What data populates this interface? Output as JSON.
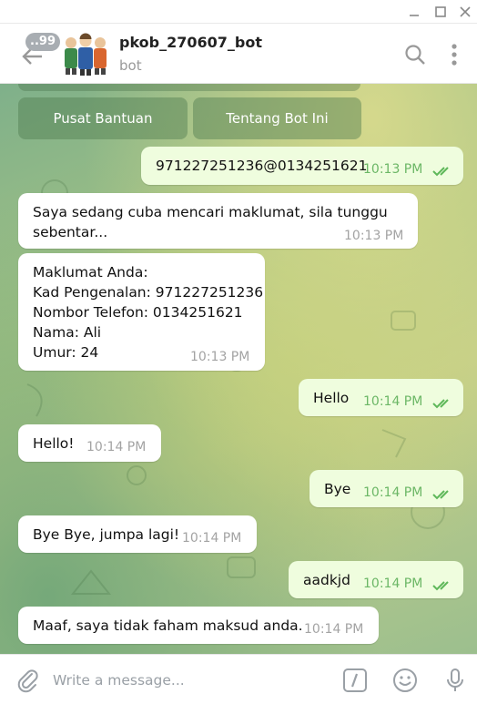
{
  "window": {
    "minimize_icon": "minimize-icon",
    "maximize_icon": "maximize-icon",
    "close_icon": "close-icon"
  },
  "header": {
    "unread_badge": "..99",
    "bot_name": "pkob_270607_bot",
    "status": "bot",
    "icons": [
      "back-arrow-icon",
      "search-icon",
      "more-vertical-icon"
    ]
  },
  "keyboard": {
    "buttons": [
      "Pusat Bantuan",
      "Tentang Bot Ini"
    ]
  },
  "messages": [
    {
      "direction": "out",
      "text": "971227251236@0134251621",
      "time": "10:13 PM",
      "read": true
    },
    {
      "direction": "in",
      "text": "Saya sedang cuba mencari maklumat, sila tunggu\nsebentar...",
      "time": "10:13 PM"
    },
    {
      "direction": "in",
      "text": "Maklumat Anda:\nKad Pengenalan: 971227251236\nNombor Telefon: 0134251621\nNama: Ali\nUmur: 24",
      "time": "10:13 PM"
    },
    {
      "direction": "out",
      "text": "Hello",
      "time": "10:14 PM",
      "read": true
    },
    {
      "direction": "in",
      "text": "Hello!",
      "time": "10:14 PM"
    },
    {
      "direction": "out",
      "text": "Bye",
      "time": "10:14 PM",
      "read": true
    },
    {
      "direction": "in",
      "text": "Bye Bye, jumpa lagi!",
      "time": "10:14 PM"
    },
    {
      "direction": "out",
      "text": "aadkjd",
      "time": "10:14 PM",
      "read": true
    },
    {
      "direction": "in",
      "text": "Maaf, saya tidak faham maksud anda.",
      "time": "10:14 PM"
    }
  ],
  "composer": {
    "placeholder": "Write a message...",
    "value": "",
    "icons": [
      "paperclip-icon",
      "bot-command-icon",
      "emoji-icon",
      "microphone-icon"
    ]
  },
  "colors": {
    "outgoing_bubble": "#effdde",
    "incoming_bubble": "#ffffff",
    "read_ticks": "#5fb85a",
    "accent": "#5b9bd5"
  }
}
